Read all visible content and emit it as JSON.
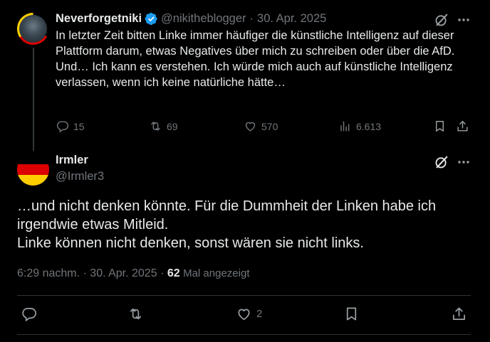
{
  "parent_post": {
    "author_name": "Neverforgetniki",
    "handle": "@nikitheblogger",
    "separator": "·",
    "date": "30. Apr. 2025",
    "text_lines": [
      "In letzter Zeit bitten Linke immer häufiger die künstliche Intelligenz auf dieser Plattform darum, etwas Negatives über mich zu schreiben oder über die AfD.",
      "Und… Ich kann es verstehen. Ich würde mich auch auf künstliche Intelligenz verlassen, wenn ich keine natürliche hätte…"
    ],
    "stats": {
      "replies": "15",
      "reposts": "69",
      "likes": "570",
      "views": "6.613"
    },
    "icons": [
      "verified-badge-icon",
      "grok-icon",
      "more-icon",
      "reply-icon",
      "repost-icon",
      "like-icon",
      "views-icon",
      "bookmark-icon",
      "share-icon"
    ]
  },
  "reply_post": {
    "author_name": "Irmler",
    "handle": "@Irmler3",
    "text_lines": [
      "…und nicht denken könnte. Für die Dummheit der Linken habe ich irgendwie etwas Mitleid.",
      "Linke können nicht denken, sonst wären sie nicht links."
    ],
    "meta": {
      "time": "6:29 nachm.",
      "separator": "·",
      "date": "30. Apr. 2025",
      "separator2": "·",
      "views_count": "62",
      "views_label": "Mal angezeigt"
    },
    "stats": {
      "likes": "2"
    }
  },
  "colors": {
    "background": "#000000",
    "text_primary": "#e7e9ea",
    "text_secondary": "#71767b",
    "verified_blue": "#1d9bf0",
    "divider": "#2f3336"
  }
}
